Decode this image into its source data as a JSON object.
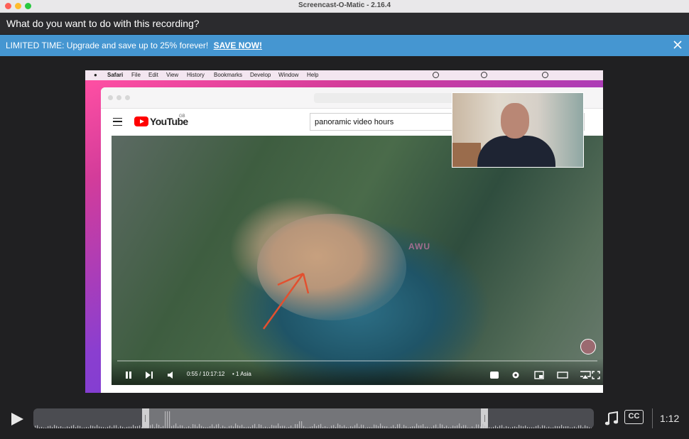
{
  "window": {
    "title": "Screencast-O-Matic - 2.16.4"
  },
  "prompt": {
    "question": "What do you want to do with this recording?"
  },
  "promo": {
    "text": "LIMITED TIME: Upgrade and save up to 25% forever!",
    "cta": "SAVE NOW!"
  },
  "preview": {
    "menubar": {
      "app": "Safari",
      "items": [
        "File",
        "Edit",
        "View",
        "History",
        "Bookmarks",
        "Develop",
        "Window",
        "Help"
      ]
    },
    "youtube": {
      "logo_text": "YouTube",
      "region": "GB",
      "search_value": "panoramic video hours"
    },
    "video": {
      "time": "0:55 / 10:17:12",
      "chapter": "• 1 Asia",
      "watermark": "AWU"
    }
  },
  "timeline": {
    "duration": "1:12",
    "cc_label": "CC",
    "selection_start_fraction": 0.194,
    "selection_end_fraction": 0.811
  },
  "colors": {
    "promo_bg": "#4596d1",
    "window_bg": "#202022",
    "youtube_red": "#ff0000"
  },
  "icons": [
    "play-icon",
    "music-note-icon",
    "close-icon",
    "apple-icon"
  ]
}
